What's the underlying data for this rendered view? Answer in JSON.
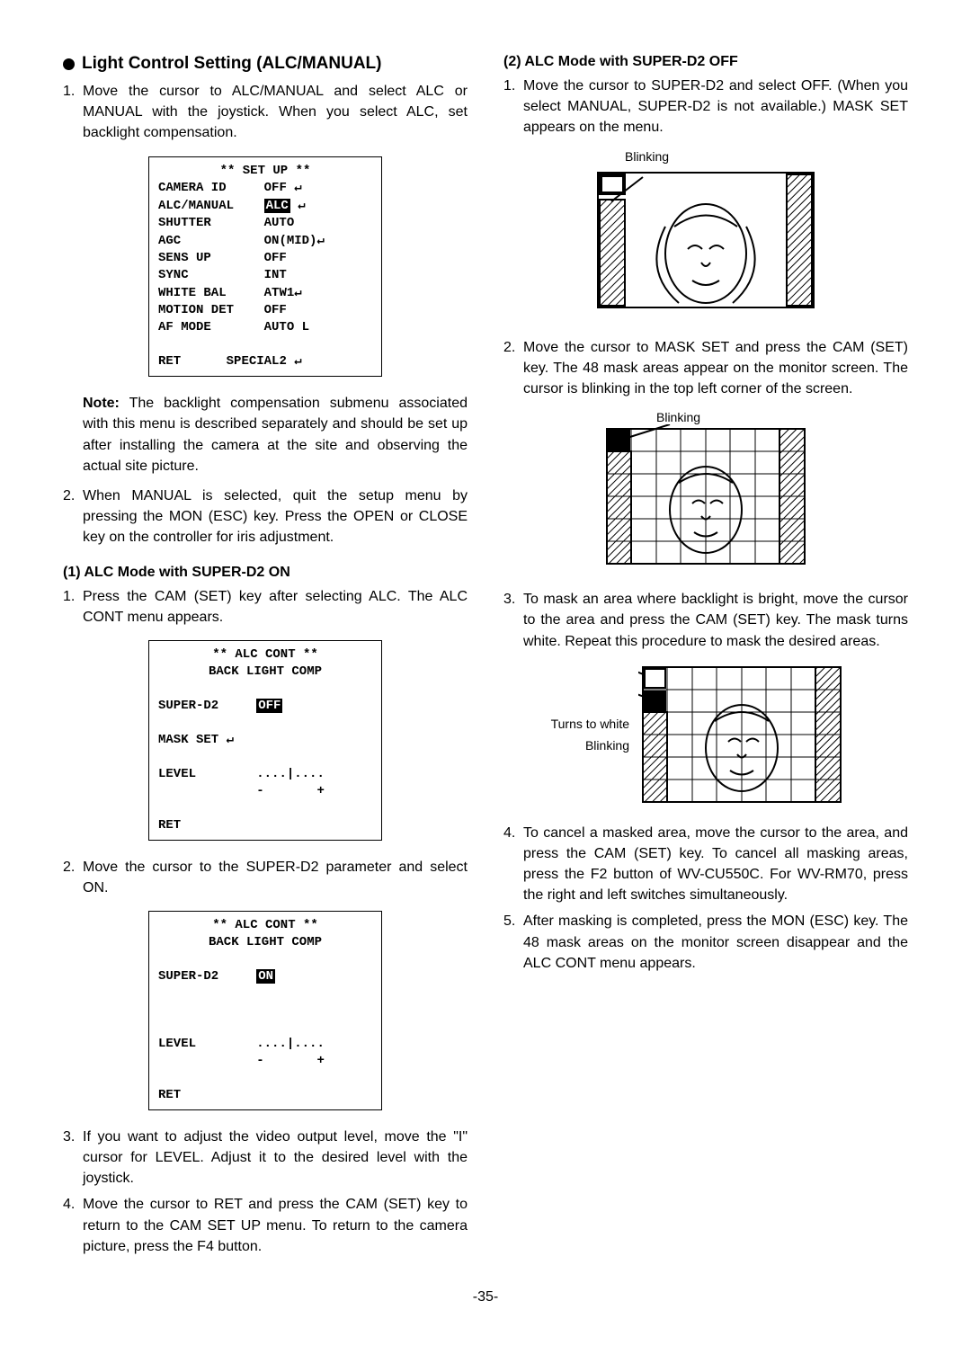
{
  "leftCol": {
    "sectionTitle": "Light Control Setting (ALC/MANUAL)",
    "item1": "Move the cursor to ALC/MANUAL and select ALC or MANUAL with the joystick. When you select ALC, set backlight compensation.",
    "osd1": {
      "title": "** SET UP **",
      "rows": [
        {
          "l": "CAMERA ID",
          "r": "OFF",
          "arr": "↵"
        },
        {
          "l": "ALC/MANUAL",
          "r": "ALC",
          "hl": true,
          "arr": "↵"
        },
        {
          "l": "SHUTTER",
          "r": "AUTO"
        },
        {
          "l": "AGC",
          "r": "ON(MID)",
          "arr": "↵"
        },
        {
          "l": "SENS UP",
          "r": "OFF"
        },
        {
          "l": "SYNC",
          "r": "INT"
        },
        {
          "l": "WHITE BAL",
          "r": "ATW1",
          "arr": "↵"
        },
        {
          "l": "MOTION DET",
          "r": "OFF"
        },
        {
          "l": "AF MODE",
          "r": "AUTO L"
        }
      ],
      "footer": {
        "l": "RET",
        "r": "SPECIAL2",
        "arr": "↵"
      }
    },
    "noteLabel": "Note:",
    "noteText": "The backlight compensation submenu associated with this menu is described separately and should be set up after installing the camera at the site and observing the actual site picture.",
    "item2": "When MANUAL is selected, quit the setup menu by pressing the MON (ESC) key. Press the OPEN or CLOSE key on the controller for iris adjustment.",
    "sub1Heading": "(1) ALC Mode with SUPER-D2 ON",
    "sub1Item1": "Press the CAM (SET) key after selecting ALC. The ALC CONT menu appears.",
    "osd2": {
      "title1": "** ALC CONT **",
      "title2": "BACK LIGHT COMP",
      "superd2": {
        "l": "SUPER-D2",
        "r": "OFF",
        "hl": true
      },
      "maskset": {
        "l": "MASK SET",
        "arr": "↵"
      },
      "level": {
        "l": "LEVEL",
        "bar": "....|....",
        "minus": "-",
        "plus": "+"
      },
      "ret": "RET"
    },
    "sub1Item2": "Move the cursor to the SUPER-D2 parameter and select ON.",
    "osd3": {
      "title1": "** ALC CONT **",
      "title2": "BACK LIGHT COMP",
      "superd2": {
        "l": "SUPER-D2",
        "r": "ON",
        "hl": true
      },
      "level": {
        "l": "LEVEL",
        "bar": "....|....",
        "minus": "-",
        "plus": "+"
      },
      "ret": "RET"
    },
    "sub1Item3": "If you want to adjust the video output level, move the \"I\" cursor for LEVEL. Adjust it to the desired level with the joystick.",
    "sub1Item4": "Move the cursor to RET and press the CAM (SET) key to return to the CAM SET UP menu. To return to the camera picture, press the F4 button."
  },
  "rightCol": {
    "sub2Heading": "(2) ALC Mode with SUPER-D2 OFF",
    "item1": "Move the cursor to SUPER-D2 and select OFF. (When you select MANUAL, SUPER-D2 is not available.) MASK SET appears on the menu.",
    "fig1Label": "Blinking",
    "item2": "Move the cursor to MASK SET and press the CAM (SET) key. The 48 mask areas appear on the monitor screen. The cursor is blinking in the top left corner of the screen.",
    "fig2Label": "Blinking",
    "item3": "To mask an area where backlight is bright, move the cursor to the area and press the CAM (SET) key. The mask turns white. Repeat this procedure to mask the desired areas.",
    "fig3Label1": "Turns to white",
    "fig3Label2": "Blinking",
    "item4": "To cancel a masked area, move the cursor to the area, and press the CAM (SET) key. To cancel all masking areas, press the F2 button of WV-CU550C. For WV-RM70, press the right and left switches simultaneously.",
    "item5": "After masking is completed, press the MON (ESC) key. The 48 mask areas on the monitor screen disappear and the ALC CONT menu appears."
  },
  "pageNumber": "-35-"
}
